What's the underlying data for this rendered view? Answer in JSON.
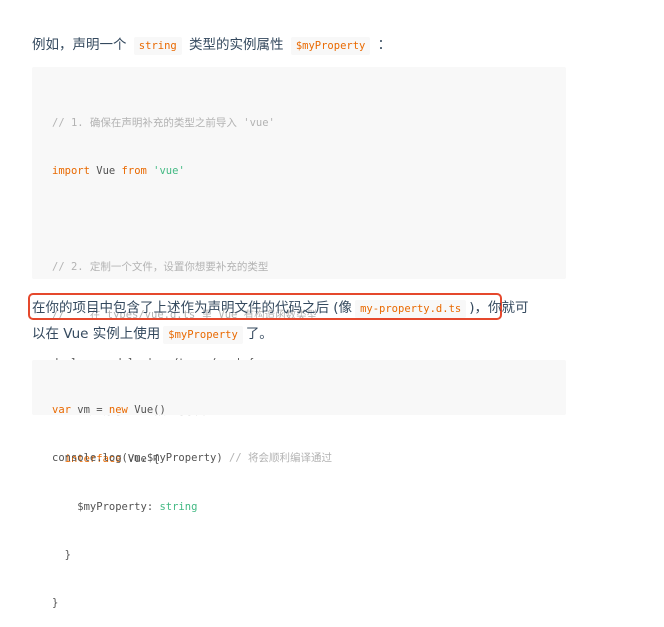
{
  "intro": {
    "prefix": "例如，声明一个",
    "code1": "string",
    "middle": "类型的实例属性",
    "code2": "$myProperty",
    "suffix": "："
  },
  "code_block_1": {
    "l1": "// 1. 确保在声明补充的类型之前导入 'vue'",
    "l2_kw": "import",
    "l2_mid": " Vue ",
    "l2_kw2": "from",
    "l2_str": " 'vue'",
    "l4": "// 2. 定制一个文件，设置你想要补充的类型",
    "l5": "//    在 types/vue.d.ts 里 Vue 有构造函数类型",
    "l6": "declare module 'vue/types/vue' {",
    "l7": "// 3. 声明为 Vue 补充的东西",
    "l8_kw": "  interface",
    "l8_rest": " Vue {",
    "l9_prop": "    $myProperty: ",
    "l9_type": "string",
    "l10": "  }",
    "l11": "}"
  },
  "para2": {
    "text1": "在你的项目中包含了上述作为声明文件的代码之后 (像",
    "code1": "my-property.d.ts",
    "text2": ")，你就可",
    "text3": "以在 Vue 实例上使用",
    "code2": "$myProperty",
    "text4": "了。"
  },
  "code_block_2": {
    "l1_kw": "var",
    "l1_mid": " vm = ",
    "l1_kw2": "new",
    "l1_rest": " Vue()",
    "l2_code": "console.log(vm.$myProperty) ",
    "l2_cm": "// 将会顺利编译通过"
  },
  "colors": {
    "inline_code": "#e96900",
    "keyword": "#e96900",
    "string": "#42b983",
    "comment": "#b3b3b3",
    "highlight_box": "#e5482d",
    "code_bg": "#f8f8f8"
  }
}
